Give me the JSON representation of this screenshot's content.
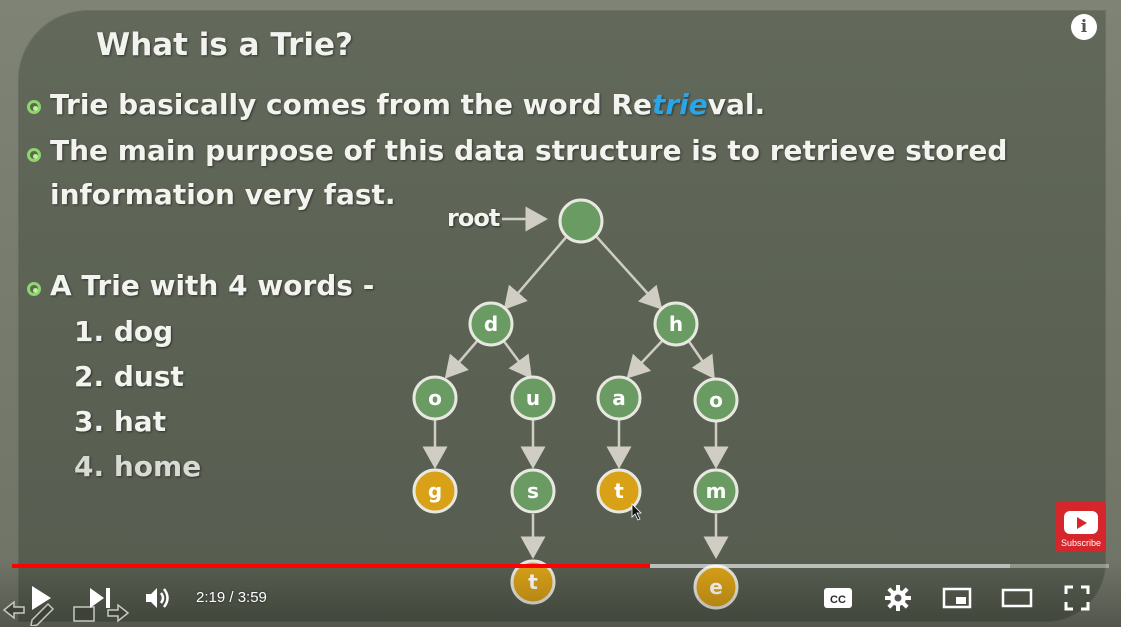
{
  "slide": {
    "title": "What is a Trie?",
    "bullet1": {
      "before": "Trie basically comes from the word Re",
      "highlight": "trie",
      "after": "val."
    },
    "bullet2_line1": "The main purpose of this data structure is to retrieve stored",
    "bullet2_line2": "information very fast.",
    "bullet3": "A Trie with 4 words -",
    "words": [
      "1. dog",
      "2. dust",
      "3. hat",
      "4. home"
    ],
    "root_label": "root",
    "nodes": {
      "root": "",
      "d": "d",
      "h": "h",
      "o1": "o",
      "u": "u",
      "a": "a",
      "o2": "o",
      "g": "g",
      "s": "s",
      "t1": "t",
      "m": "m",
      "t2": "t",
      "e": "e"
    },
    "colors": {
      "internal": "#6a9b63",
      "terminal": "#d9a118",
      "edge": "#cfcdc4",
      "highlight": "#29a6e8"
    }
  },
  "player": {
    "current_time": "2:19",
    "duration": "3:59",
    "time_display": "2:19 / 3:59",
    "progress_fraction": 0.5816,
    "buffered_fraction": 0.91,
    "subscribe_label": "Subscribe",
    "info_label": "i",
    "cc_label": "CC"
  }
}
